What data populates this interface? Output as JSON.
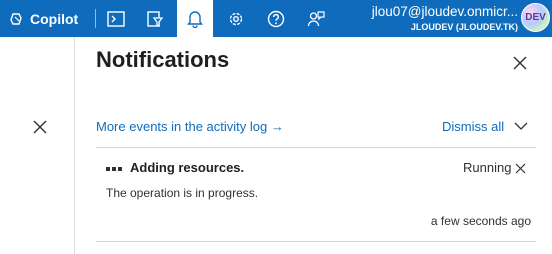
{
  "topbar": {
    "copilot_label": "Copilot",
    "icons": [
      "cloud-shell-icon",
      "directory-filter-icon",
      "notifications-bell-icon",
      "settings-gear-icon",
      "help-question-icon",
      "feedback-icon"
    ],
    "active_icon": "notifications-bell-icon",
    "account_email": "jlou07@jloudev.onmicr...",
    "account_directory": "JLOUDEV (JLOUDEV.TK)",
    "avatar_text": "DEV"
  },
  "notifications": {
    "title": "Notifications",
    "activity_link": "More events in the activity log →",
    "dismiss_label": "Dismiss all",
    "items": [
      {
        "title": "Adding resources.",
        "status": "Running",
        "description": "The operation is in progress.",
        "time": "a few seconds ago"
      }
    ]
  },
  "colors": {
    "accent": "#0f6cbd",
    "text": "#323130",
    "divider": "#d6d6d6"
  }
}
